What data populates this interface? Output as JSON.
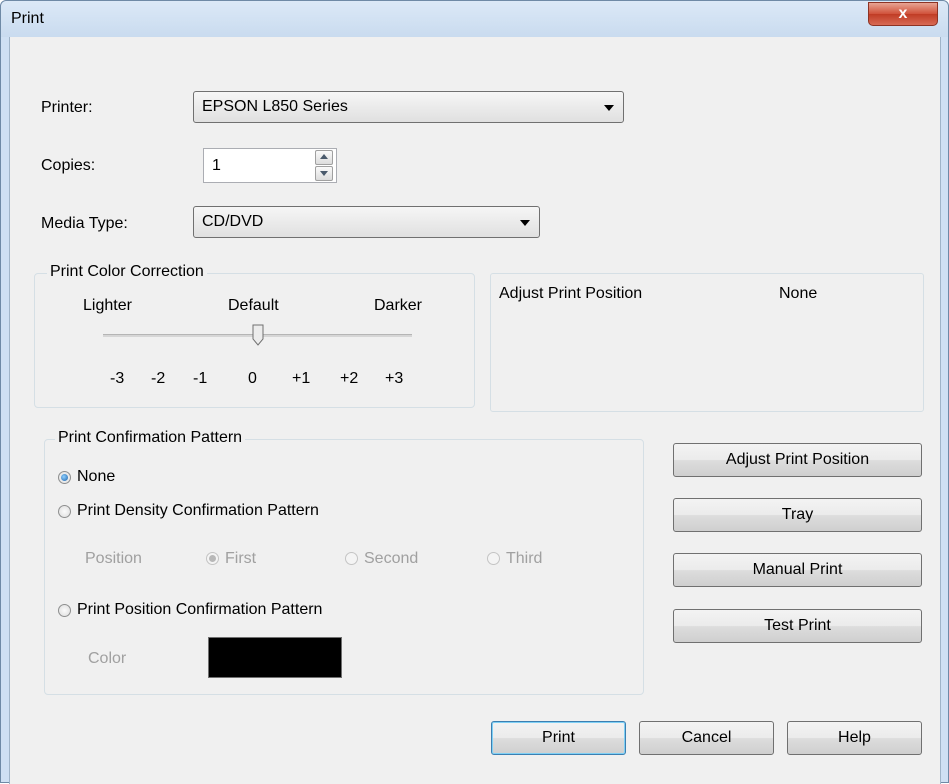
{
  "window": {
    "title": "Print",
    "close_glyph": "x"
  },
  "printer": {
    "label": "Printer:",
    "value": "EPSON L850 Series"
  },
  "copies": {
    "label": "Copies:",
    "value": "1"
  },
  "media_type": {
    "label": "Media Type:",
    "value": "CD/DVD"
  },
  "color_correction": {
    "group_title": "Print Color Correction",
    "lighter": "Lighter",
    "default": "Default",
    "darker": "Darker",
    "ticks": [
      "-3",
      "-2",
      "-1",
      "0",
      "+1",
      "+2",
      "+3"
    ],
    "value": 0
  },
  "adjust_info": {
    "label": "Adjust Print Position",
    "value": "None"
  },
  "confirmation": {
    "group_title": "Print Confirmation Pattern",
    "none": "None",
    "density": "Print Density Confirmation Pattern",
    "position_label": "Position",
    "first": "First",
    "second": "Second",
    "third": "Third",
    "position_pattern": "Print Position Confirmation Pattern",
    "color_label": "Color",
    "swatch_color": "#000000"
  },
  "side_buttons": {
    "adjust": "Adjust Print Position",
    "tray": "Tray",
    "manual": "Manual Print",
    "test": "Test Print"
  },
  "footer": {
    "print": "Print",
    "cancel": "Cancel",
    "help": "Help"
  }
}
